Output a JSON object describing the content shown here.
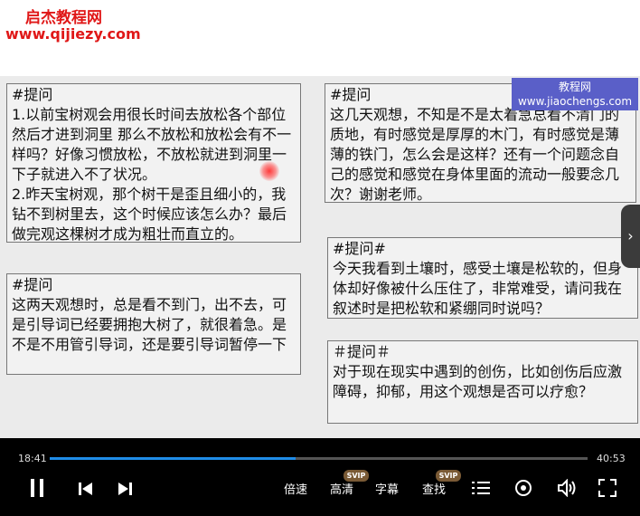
{
  "watermark": {
    "title": "启杰教程网",
    "url": "www.qijiezy.com"
  },
  "overlay_tag": {
    "line1": "教程网",
    "line2": "www.jiaochengs.com"
  },
  "notes": {
    "n1": "#提问\n1.以前宝树观会用很长时间去放松各个部位然后才进到洞里 那么不放松和放松会有不一样吗？好像习惯放松，不放松就进到洞里一下子就进入不了状况。\n2.昨天宝树观，那个树干是歪且细小的，我钻不到树里去，这个时候应该怎么办？最后做完观这棵树才成为粗壮而直立的。",
    "n2": "#提问\n这两天观想时，总是看不到门，出不去，可是引导词已经要拥抱大树了，就很着急。是不是不用管引导词，还是要引导词暂停一下",
    "n3": "#提问\n这几天观想，不知是不是太着急总看不清门的质地，有时感觉是厚厚的木门，有时感觉是薄薄的铁门，怎么会是这样？还有一个问题念自己的感觉和感觉在身体里面的流动一般要念几次？谢谢老师。",
    "n4": "#提问#\n今天我看到土壤时，感受土壤是松软的，但身体却好像被什么压住了，非常难受，请问我在叙述时是把松软和紧绷同时说吗？",
    "n5": "  ＃提问＃\n对于现在现实中遇到的创伤，比如创伤后应激障碍，抑郁，用这个观想是否可以疗愈？"
  },
  "player": {
    "current_time": "18:41",
    "total_time": "40:53",
    "progress": 0.457,
    "accent": "#1f8ce8",
    "speed_label": "倍速",
    "quality_label": "高清",
    "subtitle_label": "字幕",
    "search_label": "查找",
    "svip_badge": "SVIP",
    "icons": [
      "pause-icon",
      "previous-icon",
      "next-icon",
      "playlist-icon",
      "eye-icon",
      "volume-icon",
      "fullscreen-icon",
      "chevron-right-icon"
    ]
  }
}
